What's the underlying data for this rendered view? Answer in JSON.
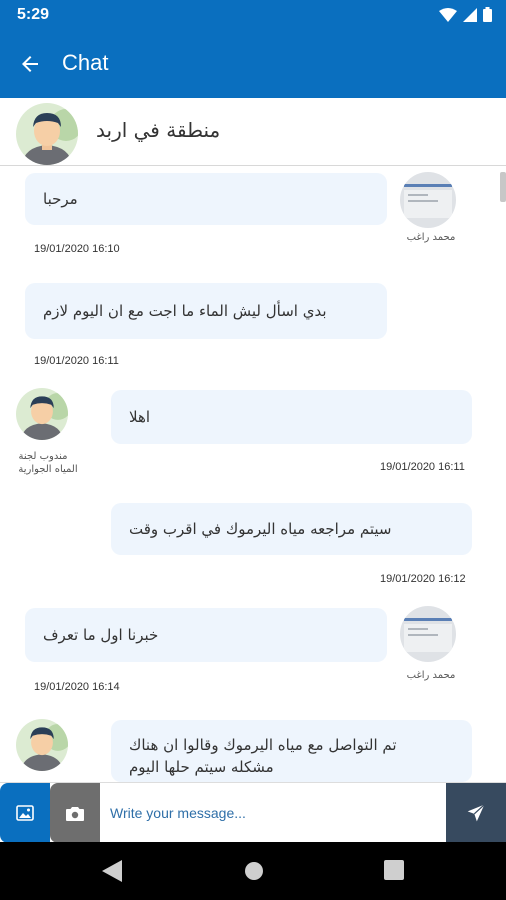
{
  "status_bar": {
    "time": "5:29"
  },
  "app_bar": {
    "title": "Chat"
  },
  "chat_header": {
    "name": "منطقة في اربد"
  },
  "messages": [
    {
      "side": "left",
      "text": "مرحبا",
      "timestamp": "19/01/2020 16:10",
      "sender": "محمد راغب"
    },
    {
      "side": "left",
      "text": "بدي اسأل ليش الماء ما اجت مع ان اليوم لازم",
      "timestamp": "19/01/2020 16:11",
      "sender": ""
    },
    {
      "side": "right",
      "text": "اهلا",
      "timestamp": "19/01/2020 16:11",
      "sender_line1": "مندوب لجنة",
      "sender_line2": "المياه الجوارية"
    },
    {
      "side": "right",
      "text": "سيتم مراجعه مياه اليرموك في اقرب وقت",
      "timestamp": "19/01/2020 16:12",
      "sender": ""
    },
    {
      "side": "left",
      "text": "خبرنا اول ما تعرف",
      "timestamp": "19/01/2020 16:14",
      "sender": "محمد راغب"
    },
    {
      "side": "right",
      "text_line1": "تم التواصل مع مياه اليرموك وقالوا ان هناك",
      "text_line2": "مشكله سيتم حلها اليوم",
      "timestamp": "",
      "sender": ""
    }
  ],
  "composer": {
    "placeholder": "Write your message..."
  },
  "colors": {
    "primary": "#0a6fbf",
    "bubble": "#eef5fd",
    "send": "#374a5f",
    "camera": "#6e6e6e"
  }
}
